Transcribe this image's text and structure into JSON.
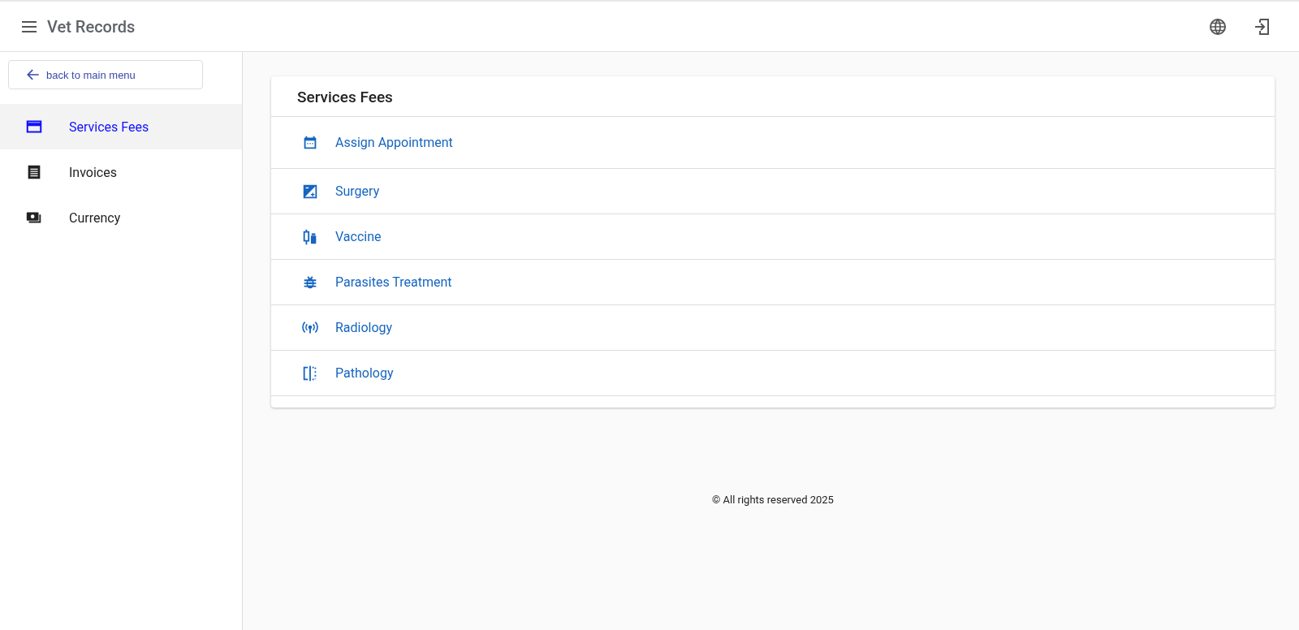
{
  "app_bar": {
    "title": "Vet Records"
  },
  "sidebar": {
    "back_button": "back to main menu",
    "items": [
      {
        "label": "Services Fees",
        "selected": true
      },
      {
        "label": "Invoices",
        "selected": false
      },
      {
        "label": "Currency",
        "selected": false
      }
    ]
  },
  "card": {
    "title": "Services Fees",
    "items": [
      {
        "label": "Assign Appointment"
      },
      {
        "label": "Surgery"
      },
      {
        "label": "Vaccine"
      },
      {
        "label": "Parasites Treatment"
      },
      {
        "label": "Radiology"
      },
      {
        "label": "Pathology"
      }
    ]
  },
  "footer": "© All rights reserved 2025"
}
